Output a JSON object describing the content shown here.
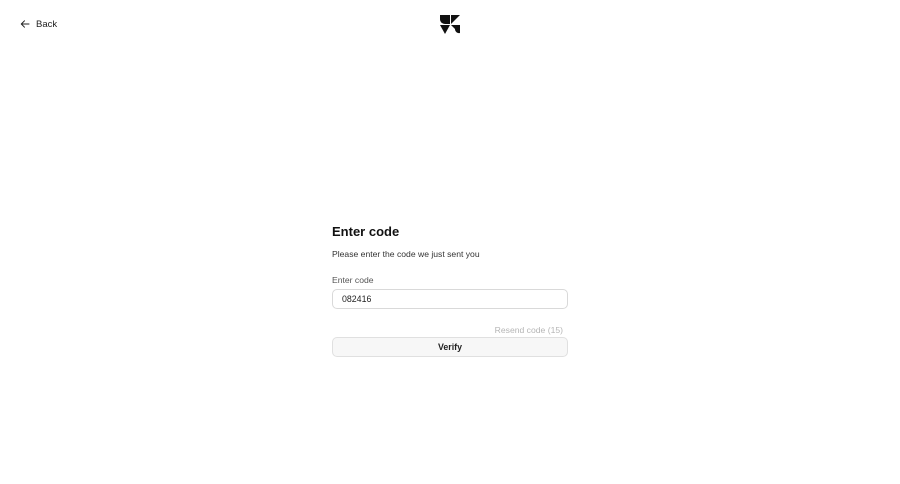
{
  "header": {
    "back_label": "Back",
    "back_icon": "arrow-left-icon",
    "logo_icon": "brand-logo-icon"
  },
  "form": {
    "title": "Enter code",
    "subtitle": "Please enter the code we just sent you",
    "field_label": "Enter code",
    "code_value": "082416",
    "resend_label": "Resend code (15)",
    "verify_label": "Verify"
  },
  "colors": {
    "text": "#1a1a1a",
    "muted": "#b5b5b5",
    "border": "#d9d9d9",
    "button_bg": "#f7f7f7"
  }
}
